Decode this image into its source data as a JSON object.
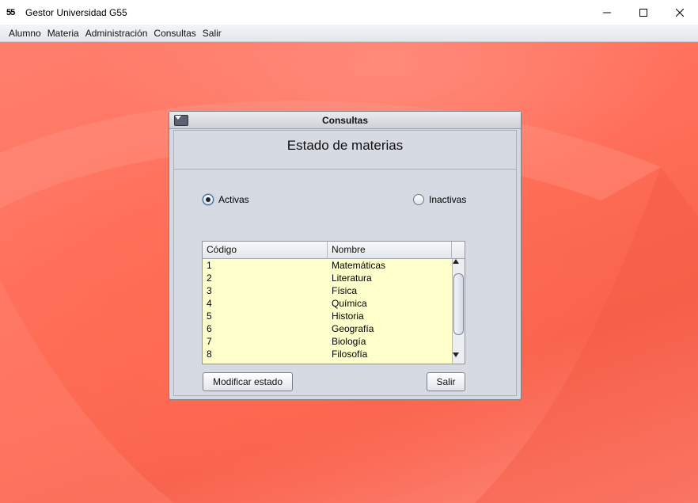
{
  "app": {
    "logo_text": "55",
    "title": "Gestor Universidad G55"
  },
  "menubar": {
    "items": [
      "Alumno",
      "Materia",
      "Administración",
      "Consultas",
      "Salir"
    ]
  },
  "window_controls": {
    "minimize_icon": "minimize-icon",
    "maximize_icon": "maximize-icon",
    "close_icon": "close-icon"
  },
  "dialog": {
    "title": "Consultas",
    "heading": "Estado de materias",
    "radio_activas": {
      "label": "Activas",
      "checked": true
    },
    "radio_inactivas": {
      "label": "Inactivas",
      "checked": false
    },
    "table": {
      "columns": [
        "Código",
        "Nombre"
      ],
      "rows": [
        [
          "1",
          "Matemáticas"
        ],
        [
          "2",
          "Literatura"
        ],
        [
          "3",
          "Física"
        ],
        [
          "4",
          "Química"
        ],
        [
          "5",
          "Historia"
        ],
        [
          "6",
          "Geografía"
        ],
        [
          "7",
          "Biología"
        ],
        [
          "8",
          "Filosofía"
        ]
      ]
    },
    "buttons": {
      "modify": "Modificar estado",
      "exit": "Salir"
    }
  },
  "colors": {
    "desktop": "#ff6e58",
    "table_bg": "#ffffcc",
    "frame_bg": "#d6dae2"
  }
}
